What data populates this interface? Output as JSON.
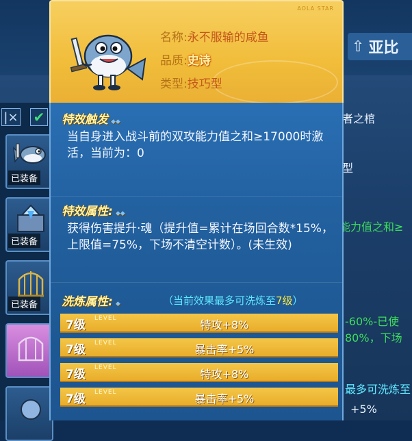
{
  "background": {
    "nav_text": "亚比",
    "filter_close": "|×",
    "filter_check": "✔",
    "equipped_label": "已装备",
    "right_fragments": [
      {
        "text": "者之棺",
        "color": "#eaf3ff"
      },
      {
        "text": "型",
        "color": "#eaf3ff"
      },
      {
        "text": "能力值之和≥",
        "color": "#3ddc5c"
      },
      {
        "text": "-60%-已使",
        "color": "#3ddc5c"
      },
      {
        "text": "80%，下场",
        "color": "#3ddc5c"
      },
      {
        "text": "最多可洗炼至",
        "color": "#5fe7ff"
      },
      {
        "text": "+5%",
        "color": "#eaf3ff"
      }
    ]
  },
  "item": {
    "brand": "AOLA STAR",
    "name_label": "名称:",
    "name_value": "永不服输的咸鱼",
    "quality_label": "品质:",
    "quality_value": "史诗",
    "type_label": "类型:",
    "type_value": "技巧型"
  },
  "trigger": {
    "title": "特效触发",
    "text": "当自身进入战斗前的双攻能力值之和≥17000时激活，当前为：0"
  },
  "effect": {
    "title": "特效属性:",
    "text": "获得伤害提升·魂（提升值=累计在场回合数*15%，上限值=75%，下场不清空计数）。(未生效)"
  },
  "wash": {
    "title": "洗炼属性:",
    "note_prefix": "（当前效果最多可洗炼至",
    "note_level": "7级",
    "note_suffix": "）",
    "level_word": "LEVEL",
    "rows": [
      {
        "level": "7级",
        "attr": "特攻+8%"
      },
      {
        "level": "7级",
        "attr": "暴击率+5%"
      },
      {
        "level": "7级",
        "attr": "特攻+8%"
      },
      {
        "level": "7级",
        "attr": "暴击率+5%"
      }
    ]
  },
  "colors": {
    "header_gold": "#f1bd3a",
    "body_blue": "#22609f",
    "title_yellow": "#fff4a8",
    "note_cyan": "#5fe7ff",
    "quality_orange": "#c4571a"
  },
  "icons": [
    "fish-equipment-icon",
    "crystal-box-icon",
    "bird-cage-icon",
    "purple-cage-icon",
    "home-icon"
  ]
}
